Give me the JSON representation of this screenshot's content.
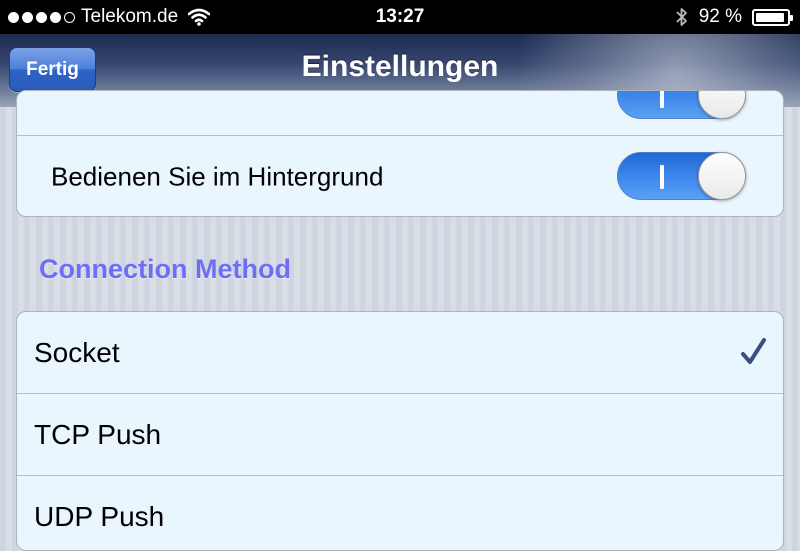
{
  "status_bar": {
    "carrier": "Telekom.de",
    "time": "13:27",
    "battery_percent": "92 %",
    "battery_level": 0.92,
    "signal_dots_filled": 4,
    "signal_dots_total": 5
  },
  "navbar": {
    "back_button_label": "Fertig",
    "title": "Einstellungen"
  },
  "settings_group": {
    "items": [
      {
        "label": "",
        "toggle_on": true
      },
      {
        "label": "Bedienen Sie im Hintergrund",
        "toggle_on": true
      }
    ]
  },
  "connection_section": {
    "header": "Connection Method",
    "options": [
      {
        "label": "Socket",
        "selected": true
      },
      {
        "label": "TCP Push",
        "selected": false
      },
      {
        "label": "UDP Push",
        "selected": false
      }
    ]
  },
  "colors": {
    "accent_header": "#6e6ef5",
    "toggle_on": "#2f78e2",
    "checkmark": "#3b4f7e"
  },
  "icons": [
    "wifi-icon",
    "bluetooth-icon",
    "battery-icon",
    "checkmark-icon"
  ]
}
